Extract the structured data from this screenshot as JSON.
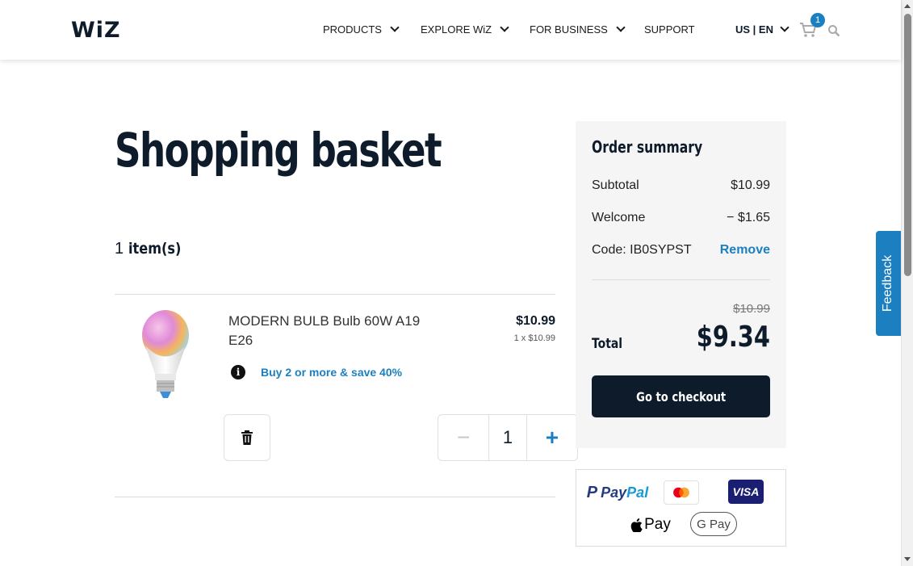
{
  "header": {
    "logo": "WiZ",
    "nav": [
      {
        "label": "PRODUCTS",
        "dropdown": true
      },
      {
        "label": "EXPLORE WiZ",
        "dropdown": true
      },
      {
        "label": "FOR BUSINESS",
        "dropdown": true
      },
      {
        "label": "SUPPORT",
        "dropdown": false
      }
    ],
    "locale": "US | EN",
    "cart_count": "1",
    "icons": [
      "cart-icon",
      "search-icon"
    ]
  },
  "basket": {
    "title": "Shopping basket",
    "count": "1",
    "count_label": "item(s)",
    "item": {
      "name": "MODERN BULB Bulb 60W A19 E26",
      "price": "$10.99",
      "unit_price": "1 x $10.99",
      "promo": "Buy 2 or more & save 40%",
      "quantity": "1",
      "minus": "−",
      "plus": "+"
    }
  },
  "summary": {
    "title": "Order summary",
    "subtotal_label": "Subtotal",
    "subtotal_value": "$10.99",
    "discount_label": "Welcome",
    "discount_value": "− $1.65",
    "code_label": "Code: IB0SYPST",
    "remove_label": "Remove",
    "original_total": "$10.99",
    "total_label": "Total",
    "total_value": "$9.34",
    "checkout_label": "Go to checkout"
  },
  "payments": {
    "paypal_a": "Pay",
    "paypal_b": "Pal",
    "visa": "VISA",
    "applepay": "Pay",
    "gpay": "G Pay"
  },
  "feedback_label": "Feedback",
  "colors": {
    "accent": "#1c7fbf",
    "navy": "#0d1b2a",
    "summary_bg": "#f5f5f5"
  }
}
